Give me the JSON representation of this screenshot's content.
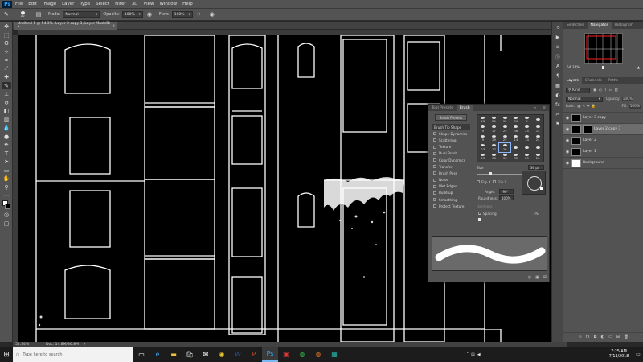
{
  "app": {
    "logo": "Ps"
  },
  "menu": [
    "File",
    "Edit",
    "Image",
    "Layer",
    "Type",
    "Select",
    "Filter",
    "3D",
    "View",
    "Window",
    "Help"
  ],
  "options": {
    "brush_size": "36",
    "mode_label": "Mode:",
    "mode_value": "Normal",
    "opacity_label": "Opacity:",
    "opacity_value": "100%",
    "flow_label": "Flow:",
    "flow_value": "100%"
  },
  "document": {
    "tab_title": "Untitled-1 @ 54.3% (Layer 2 copy 3, Layer Mask/8) *",
    "zoom": "54.34%",
    "doc_info": "Doc: 14.8M/36.8M"
  },
  "tools": [
    "move-tool",
    "marquee-tool",
    "lasso-tool",
    "quick-select-tool",
    "crop-tool",
    "eyedropper-tool",
    "healing-tool",
    "brush-tool",
    "clone-stamp-tool",
    "history-brush-tool",
    "eraser-tool",
    "gradient-tool",
    "blur-tool",
    "dodge-tool",
    "pen-tool",
    "type-tool",
    "path-select-tool",
    "shape-tool",
    "hand-tool",
    "zoom-tool",
    "edit-toolbar",
    "color-swatches",
    "quick-mask",
    "screen-mode"
  ],
  "top_right_panel": {
    "tabs": [
      "Swatches",
      "Navigator",
      "Histogram"
    ],
    "active_tab": "Navigator",
    "zoom": "54.34%"
  },
  "layers_panel": {
    "tabs": [
      "Layers",
      "Channels",
      "Paths"
    ],
    "active_tab": "Layers",
    "kind_label": "Kind",
    "blend_mode": "Normal",
    "opacity_label": "Opacity:",
    "opacity_value": "100%",
    "lock_label": "Lock:",
    "fill_label": "Fill:",
    "fill_value": "100%",
    "layers": [
      {
        "name": "Layer 3 copy",
        "visible": true,
        "selected": false,
        "thumb": "black",
        "mask": false
      },
      {
        "name": "Layer 2 copy 3",
        "visible": true,
        "selected": true,
        "thumb": "black",
        "mask": true
      },
      {
        "name": "Layer 2",
        "visible": true,
        "selected": false,
        "thumb": "black",
        "mask": false
      },
      {
        "name": "Layer 1",
        "visible": true,
        "selected": false,
        "thumb": "black",
        "mask": false
      },
      {
        "name": "Background",
        "visible": true,
        "selected": false,
        "thumb": "white",
        "mask": false
      }
    ]
  },
  "brush_panel": {
    "tabs": [
      "Tool Presets",
      "Brush"
    ],
    "active_tab": "Brush",
    "presets_button": "Brush Presets",
    "options": [
      {
        "label": "Brush Tip Shape",
        "checked": null,
        "highlight": true
      },
      {
        "label": "Shape Dynamics",
        "checked": false,
        "highlight": false
      },
      {
        "label": "Scattering",
        "checked": false,
        "highlight": false
      },
      {
        "label": "Texture",
        "checked": false,
        "highlight": false
      },
      {
        "label": "Dual Brush",
        "checked": false,
        "highlight": false
      },
      {
        "label": "Color Dynamics",
        "checked": false,
        "highlight": false
      },
      {
        "label": "Transfer",
        "checked": false,
        "highlight": false
      },
      {
        "label": "Brush Pose",
        "checked": false,
        "highlight": false
      },
      {
        "label": "Noise",
        "checked": false,
        "highlight": false
      },
      {
        "label": "Wet Edges",
        "checked": false,
        "highlight": false
      },
      {
        "label": "Build-up",
        "checked": false,
        "highlight": false
      },
      {
        "label": "Smoothing",
        "checked": true,
        "highlight": false
      },
      {
        "label": "Protect Texture",
        "checked": false,
        "highlight": false
      }
    ],
    "tip_sizes": [
      "28",
      "20",
      "30",
      "30",
      "9",
      "",
      "9",
      "17",
      "25",
      "36",
      "25",
      "14",
      "9",
      "29",
      "25",
      "14",
      "14",
      "24",
      "23",
      "17",
      "36",
      "",
      "",
      "",
      "23",
      "36",
      "36",
      "32",
      "25",
      "20"
    ],
    "size_label": "Size",
    "size_value": "36 px",
    "flip_x": "Flip X",
    "flip_y": "Flip Y",
    "angle_label": "Angle:",
    "angle_value": "-90°",
    "roundness_label": "Roundness:",
    "roundness_value": "100%",
    "hardness_label": "Hardness",
    "spacing_label": "Spacing",
    "spacing_value": "1%"
  },
  "taskbar": {
    "search_placeholder": "Type here to search",
    "time": "7:25 AM",
    "date": "7/13/2018",
    "apps": [
      "task-view",
      "edge",
      "file-explorer",
      "store",
      "mail",
      "chrome",
      "word",
      "powerpoint",
      "photoshop",
      "app-red",
      "app-green",
      "app-orange",
      "app-teal"
    ]
  }
}
